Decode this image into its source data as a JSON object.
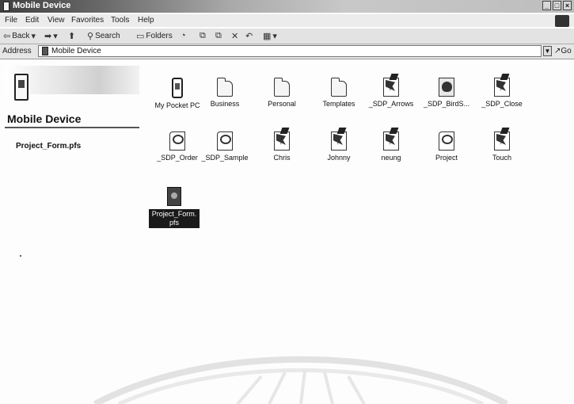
{
  "window": {
    "title": "Mobile Device"
  },
  "menu": [
    "File",
    "Edit",
    "View",
    "Favorites",
    "Tools",
    "Help"
  ],
  "toolbar": {
    "back_label": "Back",
    "search_label": "Search",
    "folders_label": "Folders"
  },
  "address": {
    "label": "Address",
    "value": "Mobile Device",
    "go_label": "Go"
  },
  "left_pane": {
    "title": "Mobile Device",
    "selected_file": "Project_Form.pfs"
  },
  "items": [
    {
      "label": "My Pocket PC",
      "icon": "pocket-pc-icon"
    },
    {
      "label": "Business",
      "icon": "folder-icon"
    },
    {
      "label": "Personal",
      "icon": "folder-icon"
    },
    {
      "label": "Templates",
      "icon": "folder-icon"
    },
    {
      "label": "_SDP_Arrows",
      "icon": "document-icon"
    },
    {
      "label": "_SDP_BirdS...",
      "icon": "bird-document-icon"
    },
    {
      "label": "_SDP_Close",
      "icon": "document-icon"
    },
    {
      "label": "_SDP_Order",
      "icon": "form-icon"
    },
    {
      "label": "_SDP_Sample",
      "icon": "form-icon"
    },
    {
      "label": "Chris",
      "icon": "document-icon"
    },
    {
      "label": "Johnny",
      "icon": "document-icon"
    },
    {
      "label": "neung",
      "icon": "document-icon"
    },
    {
      "label": "Project",
      "icon": "form-icon"
    },
    {
      "label": "Touch",
      "icon": "document-icon"
    },
    {
      "label": "Project_Form.pfs",
      "icon": "project-form-icon",
      "selected": true
    }
  ]
}
